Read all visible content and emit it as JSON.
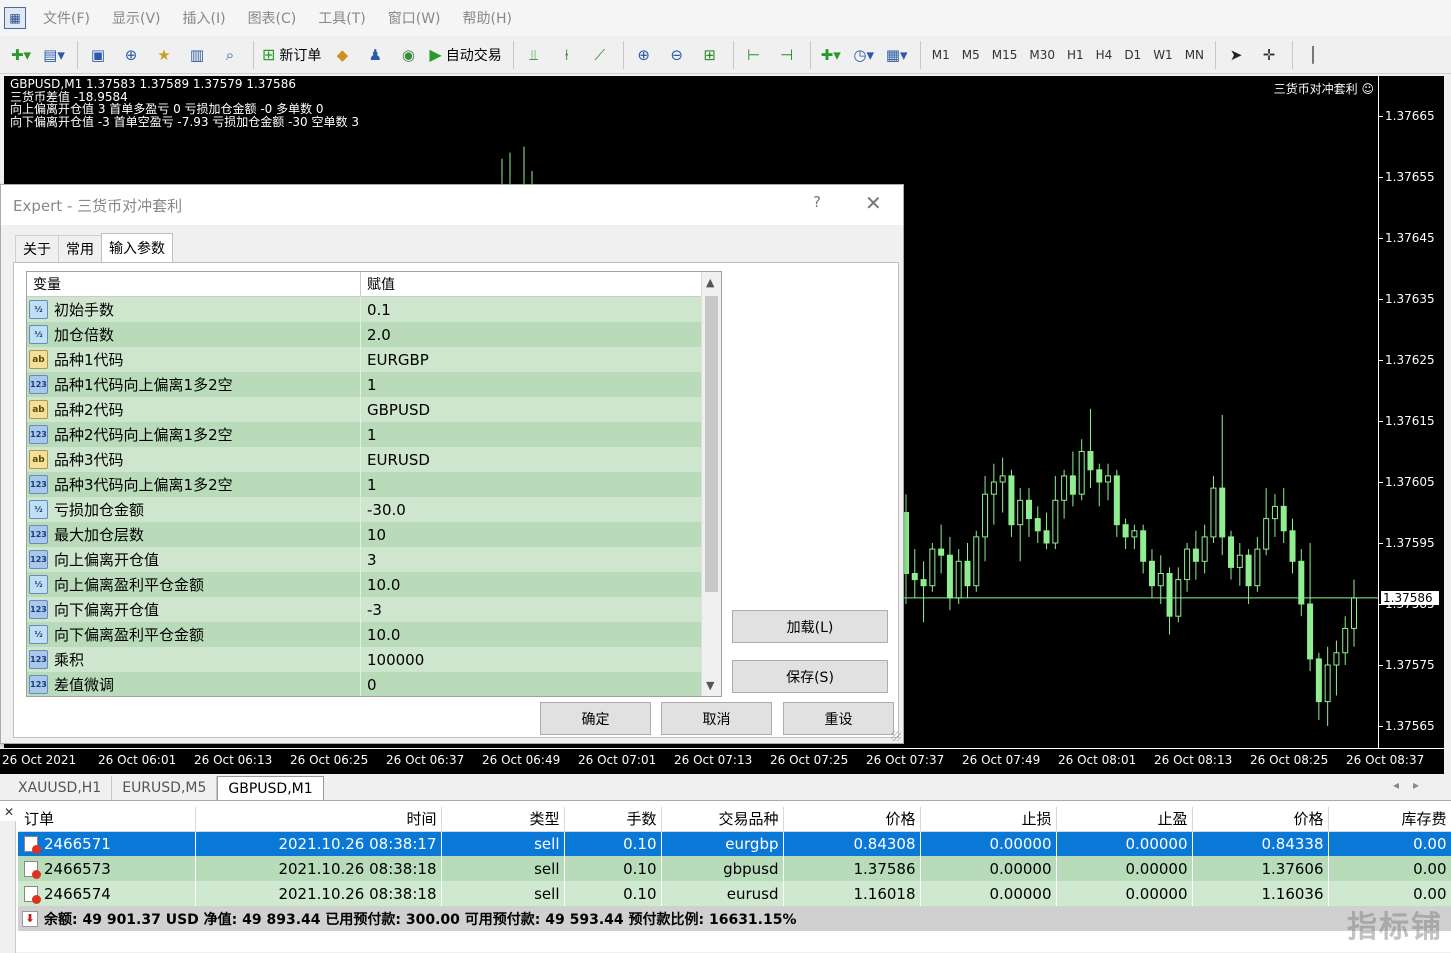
{
  "menu": {
    "items": [
      "文件(F)",
      "显示(V)",
      "插入(I)",
      "图表(C)",
      "工具(T)",
      "窗口(W)",
      "帮助(H)"
    ]
  },
  "toolbar": {
    "new_order_label": "新订单",
    "auto_trading_label": "自动交易",
    "timeframes": [
      "M1",
      "M5",
      "M15",
      "M30",
      "H1",
      "H4",
      "D1",
      "W1",
      "MN"
    ]
  },
  "chart": {
    "symbol_info": "GBPUSD,M1  1.37583 1.37589 1.37579 1.37586",
    "comment_lines": [
      "三货币差值 -18.9584",
      "向上偏离开仓值 3 首单多盈亏 0 亏损加仓金额 -0 多单数 0",
      "向下偏离开仓值 -3 首单空盈亏 -7.93 亏损加仓金额 -30 空单数 3"
    ],
    "ea_name": "三货币对冲套利 ☺",
    "price_labels": [
      "1.37665",
      "1.37655",
      "1.37645",
      "1.37635",
      "1.37625",
      "1.37615",
      "1.37605",
      "1.37595",
      "1.37585",
      "1.37575",
      "1.37565"
    ],
    "current_price": "1.37586",
    "time_labels": [
      "26 Oct 2021",
      "26 Oct 06:01",
      "26 Oct 06:13",
      "26 Oct 06:25",
      "26 Oct 06:37",
      "26 Oct 06:49",
      "26 Oct 07:01",
      "26 Oct 07:13",
      "26 Oct 07:25",
      "26 Oct 07:37",
      "26 Oct 07:49",
      "26 Oct 08:01",
      "26 Oct 08:13",
      "26 Oct 08:25",
      "26 Oct 08:37"
    ],
    "candle_color": "#90ee90",
    "candles": [
      {
        "o": 1.376,
        "h": 1.37603,
        "l": 1.37585,
        "c": 1.3759
      },
      {
        "o": 1.3759,
        "h": 1.37594,
        "l": 1.37586,
        "c": 1.37589
      },
      {
        "o": 1.37589,
        "h": 1.37592,
        "l": 1.37582,
        "c": 1.37588
      },
      {
        "o": 1.37588,
        "h": 1.37595,
        "l": 1.37587,
        "c": 1.37594
      },
      {
        "o": 1.37594,
        "h": 1.37598,
        "l": 1.3759,
        "c": 1.37593
      },
      {
        "o": 1.37593,
        "h": 1.37596,
        "l": 1.37584,
        "c": 1.37586
      },
      {
        "o": 1.37586,
        "h": 1.37594,
        "l": 1.37585,
        "c": 1.37592
      },
      {
        "o": 1.37592,
        "h": 1.37595,
        "l": 1.37586,
        "c": 1.37588
      },
      {
        "o": 1.37588,
        "h": 1.37597,
        "l": 1.37587,
        "c": 1.37596
      },
      {
        "o": 1.37596,
        "h": 1.37606,
        "l": 1.37592,
        "c": 1.37603
      },
      {
        "o": 1.37603,
        "h": 1.37608,
        "l": 1.37598,
        "c": 1.37605
      },
      {
        "o": 1.37605,
        "h": 1.37609,
        "l": 1.376,
        "c": 1.37606
      },
      {
        "o": 1.37606,
        "h": 1.37607,
        "l": 1.37596,
        "c": 1.37598
      },
      {
        "o": 1.37598,
        "h": 1.37604,
        "l": 1.37592,
        "c": 1.37602
      },
      {
        "o": 1.37602,
        "h": 1.37604,
        "l": 1.37596,
        "c": 1.37599
      },
      {
        "o": 1.37599,
        "h": 1.37601,
        "l": 1.37595,
        "c": 1.37597
      },
      {
        "o": 1.37597,
        "h": 1.376,
        "l": 1.37594,
        "c": 1.37595
      },
      {
        "o": 1.37595,
        "h": 1.37606,
        "l": 1.37594,
        "c": 1.37602
      },
      {
        "o": 1.37602,
        "h": 1.37607,
        "l": 1.37599,
        "c": 1.37606
      },
      {
        "o": 1.37606,
        "h": 1.3761,
        "l": 1.37601,
        "c": 1.37603
      },
      {
        "o": 1.37603,
        "h": 1.37612,
        "l": 1.37602,
        "c": 1.3761
      },
      {
        "o": 1.3761,
        "h": 1.37617,
        "l": 1.37604,
        "c": 1.37607
      },
      {
        "o": 1.37607,
        "h": 1.37608,
        "l": 1.37601,
        "c": 1.37605
      },
      {
        "o": 1.37605,
        "h": 1.37608,
        "l": 1.37602,
        "c": 1.37606
      },
      {
        "o": 1.37606,
        "h": 1.37607,
        "l": 1.37596,
        "c": 1.37598
      },
      {
        "o": 1.37598,
        "h": 1.37599,
        "l": 1.37594,
        "c": 1.37596
      },
      {
        "o": 1.37596,
        "h": 1.37598,
        "l": 1.37594,
        "c": 1.37597
      },
      {
        "o": 1.37597,
        "h": 1.37598,
        "l": 1.3759,
        "c": 1.37592
      },
      {
        "o": 1.37592,
        "h": 1.37594,
        "l": 1.37586,
        "c": 1.37588
      },
      {
        "o": 1.37588,
        "h": 1.37593,
        "l": 1.37585,
        "c": 1.3759
      },
      {
        "o": 1.3759,
        "h": 1.37591,
        "l": 1.3758,
        "c": 1.37583
      },
      {
        "o": 1.37583,
        "h": 1.37591,
        "l": 1.37582,
        "c": 1.37589
      },
      {
        "o": 1.37589,
        "h": 1.37595,
        "l": 1.37587,
        "c": 1.37594
      },
      {
        "o": 1.37594,
        "h": 1.37597,
        "l": 1.37589,
        "c": 1.37592
      },
      {
        "o": 1.37592,
        "h": 1.37598,
        "l": 1.3759,
        "c": 1.37596
      },
      {
        "o": 1.37596,
        "h": 1.37606,
        "l": 1.37595,
        "c": 1.37604
      },
      {
        "o": 1.37604,
        "h": 1.37616,
        "l": 1.37593,
        "c": 1.37596
      },
      {
        "o": 1.37596,
        "h": 1.37597,
        "l": 1.37589,
        "c": 1.37591
      },
      {
        "o": 1.37591,
        "h": 1.37595,
        "l": 1.37588,
        "c": 1.37593
      },
      {
        "o": 1.37593,
        "h": 1.37594,
        "l": 1.37585,
        "c": 1.37588
      },
      {
        "o": 1.37588,
        "h": 1.37596,
        "l": 1.37587,
        "c": 1.37594
      },
      {
        "o": 1.37594,
        "h": 1.37604,
        "l": 1.37593,
        "c": 1.37599
      },
      {
        "o": 1.37599,
        "h": 1.37603,
        "l": 1.37596,
        "c": 1.37601
      },
      {
        "o": 1.37601,
        "h": 1.37604,
        "l": 1.37595,
        "c": 1.37597
      },
      {
        "o": 1.37597,
        "h": 1.37599,
        "l": 1.3759,
        "c": 1.37592
      },
      {
        "o": 1.37592,
        "h": 1.37594,
        "l": 1.37583,
        "c": 1.37585
      },
      {
        "o": 1.37585,
        "h": 1.37595,
        "l": 1.37574,
        "c": 1.37576
      },
      {
        "o": 1.37576,
        "h": 1.37577,
        "l": 1.37566,
        "c": 1.37569
      },
      {
        "o": 1.37569,
        "h": 1.37578,
        "l": 1.37565,
        "c": 1.37575
      },
      {
        "o": 1.37575,
        "h": 1.37579,
        "l": 1.3757,
        "c": 1.37577
      },
      {
        "o": 1.37577,
        "h": 1.37583,
        "l": 1.37575,
        "c": 1.37581
      },
      {
        "o": 1.37581,
        "h": 1.37589,
        "l": 1.37578,
        "c": 1.37586
      }
    ]
  },
  "chart_tabs": [
    "XAUUSD,H1",
    "EURUSD,M5",
    "GBPUSD,M1"
  ],
  "chart_tabs_active": 2,
  "dialog": {
    "title": "Expert - 三货币对冲套利",
    "help": "?",
    "close": "✕",
    "tabs": [
      "关于",
      "常用",
      "输入参数"
    ],
    "active_tab": 2,
    "col_variable": "变量",
    "col_value": "赋值",
    "params": [
      {
        "type": "dbl",
        "icon": "½",
        "name": "初始手数",
        "value": "0.1"
      },
      {
        "type": "dbl",
        "icon": "½",
        "name": "加仓倍数",
        "value": "2.0"
      },
      {
        "type": "str",
        "icon": "ab",
        "name": "品种1代码",
        "value": "EURGBP"
      },
      {
        "type": "int",
        "icon": "123",
        "name": "品种1代码向上偏离1多2空",
        "value": "1"
      },
      {
        "type": "str",
        "icon": "ab",
        "name": "品种2代码",
        "value": "GBPUSD"
      },
      {
        "type": "int",
        "icon": "123",
        "name": "品种2代码向上偏离1多2空",
        "value": "1"
      },
      {
        "type": "str",
        "icon": "ab",
        "name": "品种3代码",
        "value": "EURUSD"
      },
      {
        "type": "int",
        "icon": "123",
        "name": "品种3代码向上偏离1多2空",
        "value": "1"
      },
      {
        "type": "dbl",
        "icon": "½",
        "name": "亏损加仓金额",
        "value": "-30.0"
      },
      {
        "type": "int",
        "icon": "123",
        "name": "最大加仓层数",
        "value": "10"
      },
      {
        "type": "int",
        "icon": "123",
        "name": "向上偏离开仓值",
        "value": "3"
      },
      {
        "type": "dbl",
        "icon": "½",
        "name": "向上偏离盈利平仓金额",
        "value": "10.0"
      },
      {
        "type": "int",
        "icon": "123",
        "name": "向下偏离开仓值",
        "value": "-3"
      },
      {
        "type": "dbl",
        "icon": "½",
        "name": "向下偏离盈利平仓金额",
        "value": "10.0"
      },
      {
        "type": "int",
        "icon": "123",
        "name": "乘积",
        "value": "100000"
      },
      {
        "type": "int",
        "icon": "123",
        "name": "差值微调",
        "value": "0"
      }
    ],
    "load_label": "加载(L)",
    "save_label": "保存(S)",
    "ok_label": "确定",
    "cancel_label": "取消",
    "reset_label": "重设"
  },
  "terminal": {
    "close": "✕",
    "columns": [
      "订单",
      "时间",
      "类型",
      "手数",
      "交易品种",
      "价格",
      "止损",
      "止盈",
      "价格",
      "库存费"
    ],
    "orders": [
      {
        "ticket": "2466571",
        "time": "2021.10.26 08:38:17",
        "type": "sell",
        "lots": "0.10",
        "symbol": "eurgbp",
        "open": "0.84308",
        "sl": "0.00000",
        "tp": "0.00000",
        "price": "0.84338",
        "swap": "0.00"
      },
      {
        "ticket": "2466573",
        "time": "2021.10.26 08:38:18",
        "type": "sell",
        "lots": "0.10",
        "symbol": "gbpusd",
        "open": "1.37586",
        "sl": "0.00000",
        "tp": "0.00000",
        "price": "1.37606",
        "swap": "0.00"
      },
      {
        "ticket": "2466574",
        "time": "2021.10.26 08:38:18",
        "type": "sell",
        "lots": "0.10",
        "symbol": "eurusd",
        "open": "1.16018",
        "sl": "0.00000",
        "tp": "0.00000",
        "price": "1.16036",
        "swap": "0.00"
      }
    ],
    "summary": "余额: 49 901.37 USD  净值: 49 893.44  已用预付款: 300.00  可用预付款: 49 593.44  预付款比例: 16631.15%"
  },
  "watermark": "指标铺"
}
